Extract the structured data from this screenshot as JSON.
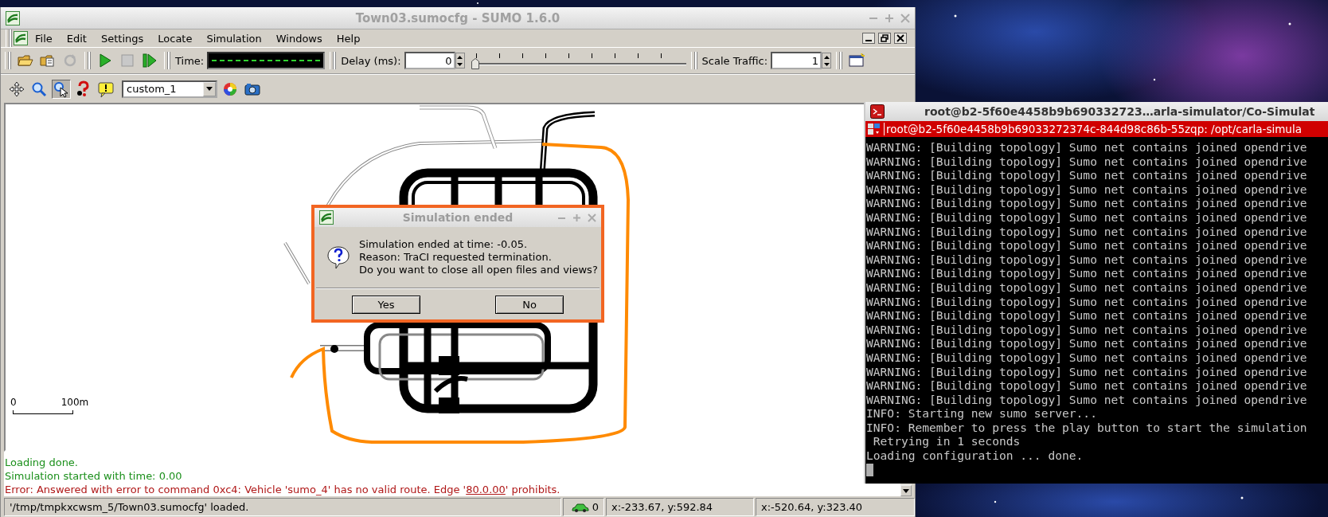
{
  "sumo_window": {
    "title": "Town03.sumocfg - SUMO 1.6.0",
    "menu": [
      "File",
      "Edit",
      "Settings",
      "Locate",
      "Simulation",
      "Windows",
      "Help"
    ],
    "toolbar": {
      "time_label": "Time:",
      "delay_label": "Delay (ms):",
      "delay_value": "0",
      "delay_slider": {
        "level": 0
      },
      "scale_label": "Scale Traffic:",
      "scale_value": "1"
    },
    "view_toolbar": {
      "tools": [
        {
          "kind": "pan",
          "selected": false
        },
        {
          "kind": "zoom",
          "selected": false
        },
        {
          "kind": "select",
          "selected": true
        },
        {
          "kind": "info",
          "selected": false
        },
        {
          "kind": "tooltip",
          "selected": false
        }
      ],
      "scheme": "custom_1"
    },
    "map": {
      "scale_start": "0",
      "scale_end": "100m"
    },
    "messages": [
      {
        "kind": "info",
        "text": "Loading done."
      },
      {
        "kind": "info",
        "text": "Simulation started with time: 0.00"
      },
      {
        "kind": "error",
        "text": "Error: Answered with error to command 0xc4: Vehicle 'sumo_4' has no valid route. Edge '",
        "link": "80.0.00",
        "after": "' prohibits."
      }
    ],
    "status_bar": {
      "file": "'/tmp/tmpkxcwsm_5/Town03.sumocfg' loaded.",
      "vehicles": "0",
      "coords_1": "x:-233.67, y:592.84",
      "coords_2": "x:-520.64, y:323.40"
    }
  },
  "dialog": {
    "title": "Simulation ended",
    "lines": [
      "Simulation ended at time: -0.05.",
      "Reason: TraCI requested termination.",
      "Do you want to close all open files and views?"
    ],
    "buttons": [
      "Yes",
      "No"
    ]
  },
  "terminal": {
    "title": "root@b2-5f60e4458b9b690332723…arla-simulator/Co-Simulat",
    "tab": "root@b2-5f60e4458b9b69033272374c-844d98c86b-55zqp: /opt/carla-simula",
    "lines": [
      "WARNING: [Building topology] Sumo net contains joined opendrive",
      "WARNING: [Building topology] Sumo net contains joined opendrive",
      "WARNING: [Building topology] Sumo net contains joined opendrive",
      "WARNING: [Building topology] Sumo net contains joined opendrive",
      "WARNING: [Building topology] Sumo net contains joined opendrive",
      "WARNING: [Building topology] Sumo net contains joined opendrive",
      "WARNING: [Building topology] Sumo net contains joined opendrive",
      "WARNING: [Building topology] Sumo net contains joined opendrive",
      "WARNING: [Building topology] Sumo net contains joined opendrive",
      "WARNING: [Building topology] Sumo net contains joined opendrive",
      "WARNING: [Building topology] Sumo net contains joined opendrive",
      "WARNING: [Building topology] Sumo net contains joined opendrive",
      "WARNING: [Building topology] Sumo net contains joined opendrive",
      "WARNING: [Building topology] Sumo net contains joined opendrive",
      "WARNING: [Building topology] Sumo net contains joined opendrive",
      "WARNING: [Building topology] Sumo net contains joined opendrive",
      "WARNING: [Building topology] Sumo net contains joined opendrive",
      "WARNING: [Building topology] Sumo net contains joined opendrive",
      "WARNING: [Building topology] Sumo net contains joined opendrive",
      "INFO: Starting new sumo server...",
      "INFO: Remember to press the play button to start the simulation",
      " Retrying in 1 seconds",
      "Loading configuration ... done."
    ]
  }
}
